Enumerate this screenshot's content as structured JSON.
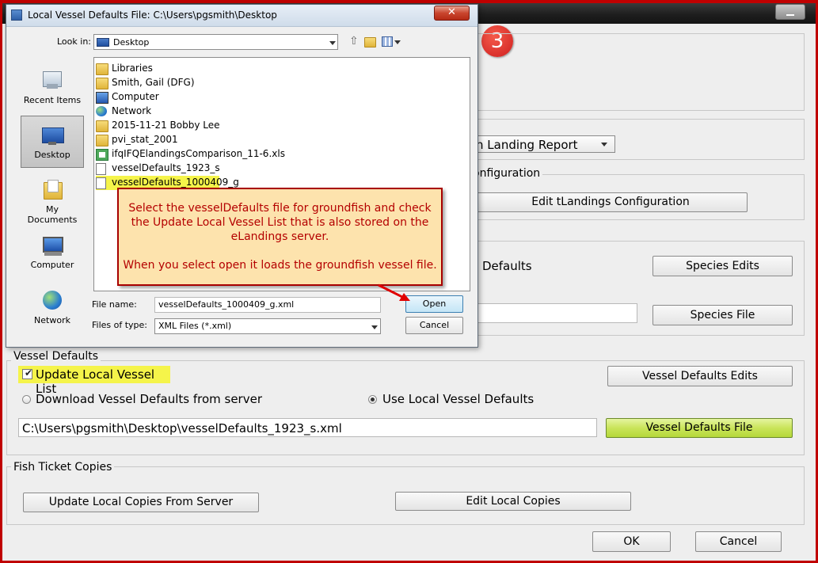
{
  "main": {
    "step_badge": "3",
    "landing_report_select": "n Landing Report",
    "tlandings_group_label": "onfiguration",
    "edit_tlandings_button": "Edit tLandings Configuration",
    "species_defaults_label": "Defaults",
    "species_edits_button": "Species Edits",
    "species_file_value": "",
    "species_file_button": "Species File",
    "vessel_defaults": {
      "group_label": "Vessel Defaults",
      "update_checkbox_label": "Update Local Vessel List",
      "update_checked": true,
      "edits_button": "Vessel Defaults Edits",
      "radio_download_label": "Download Vessel Defaults from server",
      "radio_local_label": "Use Local Vessel Defaults",
      "selected_radio": "local",
      "file_path": "C:\\Users\\pgsmith\\Desktop\\vesselDefaults_1923_s.xml",
      "file_button": "Vessel Defaults File"
    },
    "fish_ticket": {
      "group_label": "Fish Ticket Copies",
      "update_button": "Update Local Copies From Server",
      "edit_button": "Edit Local Copies"
    },
    "ok_button": "OK",
    "cancel_button": "Cancel"
  },
  "dialog": {
    "title": "Local Vessel Defaults File: C:\\Users\\pgsmith\\Desktop",
    "look_in_label": "Look in:",
    "look_in_value": "Desktop",
    "sidebar": [
      {
        "label": "Recent Items",
        "icon": "recent-items-icon"
      },
      {
        "label": "Desktop",
        "icon": "desktop-icon",
        "selected": true
      },
      {
        "label": "My Documents",
        "icon": "my-documents-icon"
      },
      {
        "label": "Computer",
        "icon": "computer-icon"
      },
      {
        "label": "Network",
        "icon": "network-icon"
      }
    ],
    "files": [
      {
        "name": "Libraries",
        "icon": "libraries-icon"
      },
      {
        "name": "Smith, Gail (DFG)",
        "icon": "user-folder-icon"
      },
      {
        "name": "Computer",
        "icon": "computer-icon"
      },
      {
        "name": "Network",
        "icon": "network-icon"
      },
      {
        "name": "2015-11-21 Bobby Lee",
        "icon": "folder-icon"
      },
      {
        "name": "pvi_stat_2001",
        "icon": "folder-icon"
      },
      {
        "name": "ifqIFQElandingsComparison_11-6.xls",
        "icon": "excel-file-icon"
      },
      {
        "name": "vesselDefaults_1923_s",
        "icon": "document-icon"
      },
      {
        "name": "vesselDefaults_1000409_g",
        "icon": "document-icon",
        "selected": true
      }
    ],
    "file_name_label": "File name:",
    "file_name_value": "vesselDefaults_1000409_g.xml",
    "file_type_label": "Files of type:",
    "file_type_value": "XML Files (*.xml)",
    "open_button": "Open",
    "cancel_button": "Cancel"
  },
  "callout": {
    "line1": "Select the vesselDefaults file for groundfish and check",
    "line2": "the Update Local Vessel List that is also stored on the",
    "line3": "eLandings server.",
    "line4": "When you select open it loads the groundfish vessel file."
  },
  "colors": {
    "frame_red": "#c00000",
    "highlight_yellow": "#f5f44a",
    "callout_fill": "#fde3ad",
    "callout_text": "#b40000",
    "green_button": "#c9e45a"
  }
}
